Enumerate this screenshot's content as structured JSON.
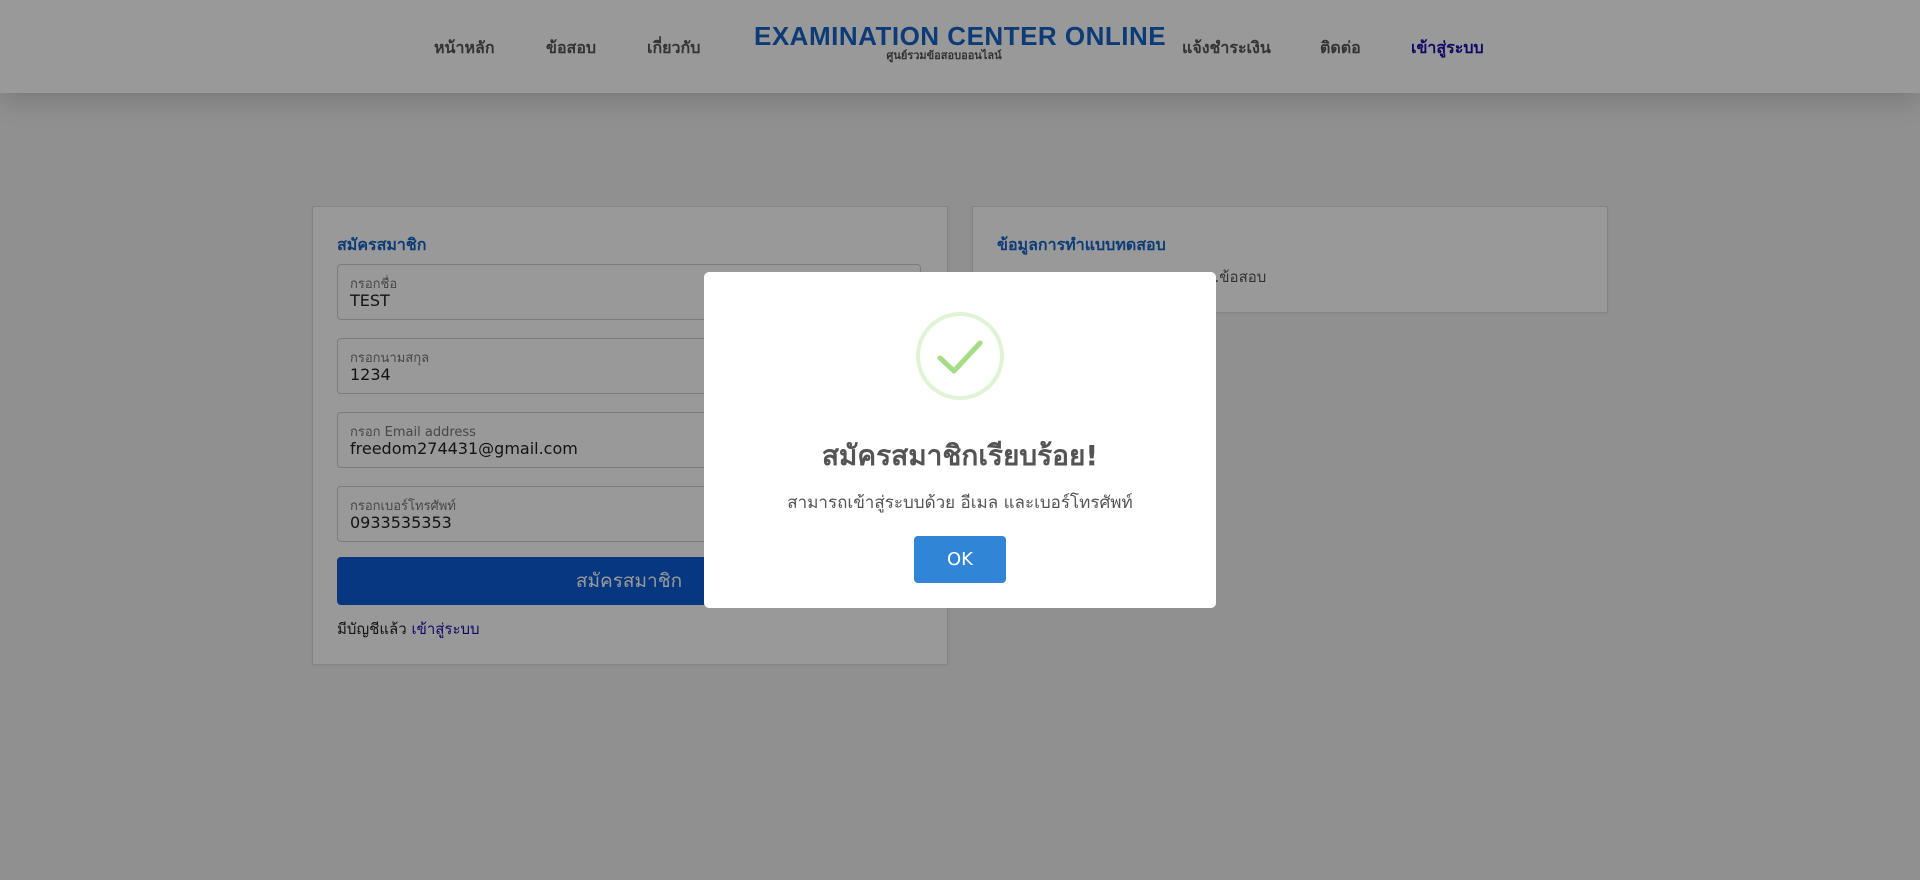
{
  "nav": {
    "home": "หน้าหลัก",
    "exams": "ข้อสอบ",
    "about": "เกี่ยวกับ",
    "payment": "แจ้งชำระเงิน",
    "contact": "ติดต่อ",
    "login": "เข้าสู่ระบบ"
  },
  "brand": {
    "title": "EXAMINATION CENTER ONLINE",
    "subtitle": "ศูนย์รวมข้อสอบออนไลน์"
  },
  "register": {
    "title": "สมัครสมาชิก",
    "fields": [
      {
        "label": "กรอกชื่อ",
        "value": "TEST"
      },
      {
        "label": "กรอกนามสกุล",
        "value": "1234"
      },
      {
        "label": "กรอก Email address",
        "value": "freedom274431@gmail.com"
      },
      {
        "label": "กรอกเบอร์โทรศัพท์",
        "value": "0933535353"
      }
    ],
    "submit_label": "สมัครสมาชิก",
    "have_account": "มีบัญชีแล้ว",
    "login_link": "เข้าสู่ระบบ"
  },
  "info": {
    "title": "ข้อมูลการทำแบบทดสอบ",
    "text": "...ข้อสอบ"
  },
  "modal": {
    "icon": "success-check-icon",
    "title": "สมัครสมาชิกเรียบร้อย!",
    "text": "สามารถเข้าสู่ระบบด้วย อีเมล และเบอร์โทรศัพท์",
    "ok_label": "OK"
  },
  "colors": {
    "brand": "#1465c7",
    "submit": "#0d5cd8",
    "ok": "#3085d6",
    "success": "#a5dc86"
  }
}
